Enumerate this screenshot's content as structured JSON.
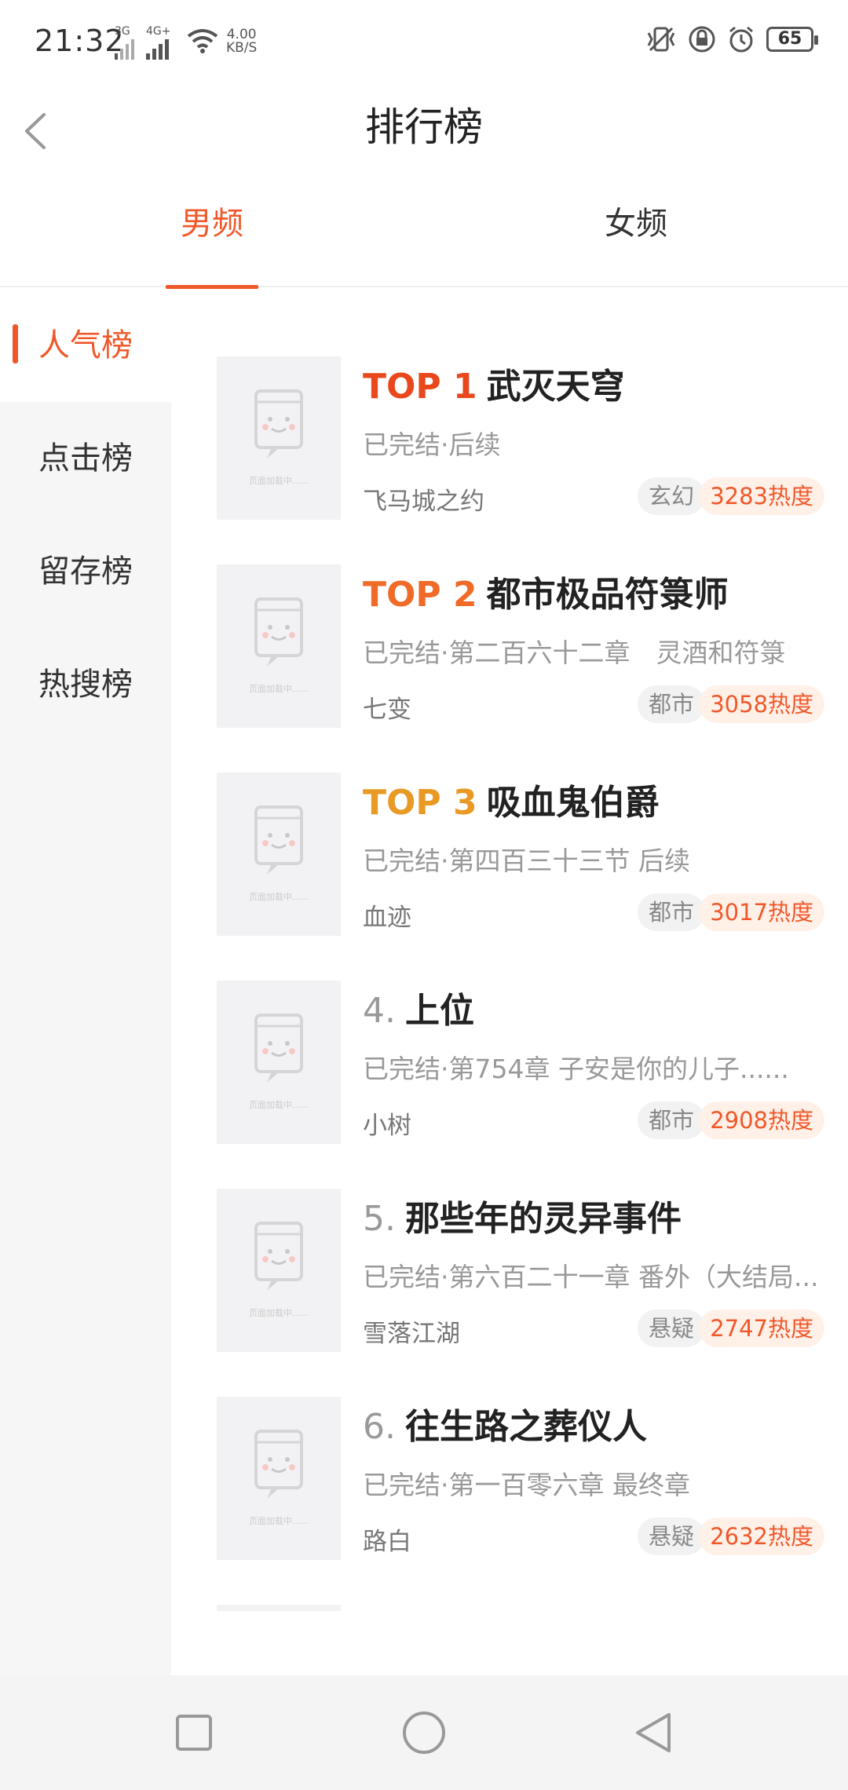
{
  "status_bar": {
    "time": "21:32",
    "net1": "3G",
    "net2": "4G+",
    "speed_value": "4.00",
    "speed_unit": "KB/S",
    "battery": "65"
  },
  "header": {
    "title": "排行榜",
    "back_icon": "chevron-left-icon"
  },
  "tabs": [
    {
      "label": "男频",
      "active": true
    },
    {
      "label": "女频",
      "active": false
    }
  ],
  "sidebar": {
    "items": [
      {
        "label": "人气榜",
        "active": true
      },
      {
        "label": "点击榜",
        "active": false
      },
      {
        "label": "留存榜",
        "active": false
      },
      {
        "label": "热搜榜",
        "active": false
      }
    ]
  },
  "books": [
    {
      "rank": "TOP 1",
      "title": "武灭天穹",
      "meta": "已完结·后续",
      "author": "飞马城之约",
      "category": "玄幻",
      "heat": "3283热度"
    },
    {
      "rank": "TOP 2",
      "title": "都市极品符箓师",
      "meta": "已完结·第二百六十二章　灵酒和符箓",
      "author": "七变",
      "category": "都市",
      "heat": "3058热度"
    },
    {
      "rank": "TOP 3",
      "title": "吸血鬼伯爵",
      "meta": "已完结·第四百三十三节 后续",
      "author": "血迹",
      "category": "都市",
      "heat": "3017热度"
    },
    {
      "rank": "4.",
      "title": "上位",
      "meta": "已完结·第754章  子安是你的儿子......",
      "author": "小树",
      "category": "都市",
      "heat": "2908热度"
    },
    {
      "rank": "5.",
      "title": "那些年的灵异事件",
      "meta": "已完结·第六百二十一章 番外（大结局...",
      "author": "雪落江湖",
      "category": "悬疑",
      "heat": "2747热度"
    },
    {
      "rank": "6.",
      "title": "往生路之葬仪人",
      "meta": "已完结·第一百零六章  最终章",
      "author": "路白",
      "category": "悬疑",
      "heat": "2632热度"
    }
  ],
  "cover_placeholder": "页面加载中......",
  "colors": {
    "accent": "#f0582a",
    "top1": "#e8481c",
    "top2": "#f06a28",
    "top3": "#e89a25"
  },
  "nav": {
    "icons": [
      "square-icon",
      "circle-icon",
      "triangle-back-icon"
    ]
  }
}
